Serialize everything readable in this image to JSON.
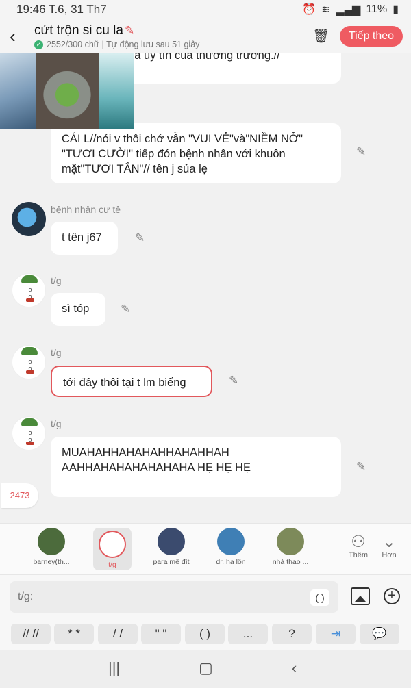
{
  "status": {
    "time": "19:46 T.6, 31 Th7",
    "battery": "11%"
  },
  "header": {
    "title": "cứt trộn si cu la",
    "subtitle": "2552/300 chữ | Tự động lưu sau 51 giây",
    "next_label": "Tiếp theo"
  },
  "messages": [
    {
      "text": "n chất lượng và uy tín của thương trường.//"
    },
    {
      "text": "CÁI L//nói v thôi chớ vẫn \"VUI VẺ\"và\"NIỀM NỞ\" \"TƯƠI CƯỜI\" tiếp đón bệnh nhân với khuôn mặt\"TƯƠI TẮN\"// tên j sủa lẹ"
    },
    {
      "name": "bệnh nhân cư tê",
      "text": "t tên j67"
    },
    {
      "name": "t/g",
      "text": "sì tóp"
    },
    {
      "name": "t/g",
      "text": "tới đây thôi tại t lm biếng"
    },
    {
      "name": "t/g",
      "text": "MUAHAHHAHAHAHHAHAHHAH AAHHAHAHAHAHAHAHA HẸ HẸ HẸ"
    }
  ],
  "counter": "2473",
  "characters": [
    {
      "label": "barney(th...",
      "color": "#4c6b3c"
    },
    {
      "label": "t/g",
      "color": "#ffffff"
    },
    {
      "label": "para mê đít",
      "color": "#3b4b6e"
    },
    {
      "label": "dr. ha lồn",
      "color": "#3f7fb5"
    },
    {
      "label": "nhà thao ...",
      "color": "#7d8a5a"
    }
  ],
  "side_buttons": {
    "more": "Thêm",
    "less": "Hơn"
  },
  "input": {
    "placeholder": "t/g:",
    "paren": "( )"
  },
  "format_buttons": [
    "// //",
    "* *",
    "/ /",
    "\" \"",
    "( )",
    "...",
    "?"
  ]
}
